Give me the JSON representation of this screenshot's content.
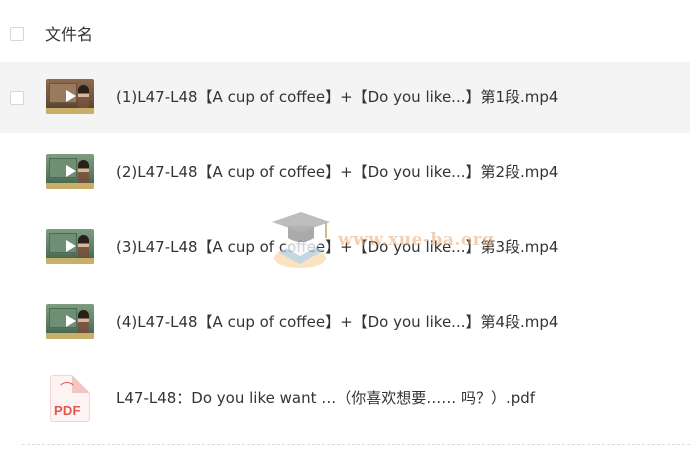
{
  "header": {
    "column_title": "文件名"
  },
  "files": [
    {
      "name": "(1)L47-L48【A cup of coffee】+【Do you like...】第1段.mp4",
      "type": "video",
      "thumbnail_icon": "video-thumbnail-icon",
      "selected": true
    },
    {
      "name": "(2)L47-L48【A cup of coffee】+【Do you like...】第2段.mp4",
      "type": "video",
      "thumbnail_icon": "video-thumbnail-icon",
      "selected": false
    },
    {
      "name": "(3)L47-L48【A cup of coffee】+【Do you like...】第3段.mp4",
      "type": "video",
      "thumbnail_icon": "video-thumbnail-icon",
      "selected": false
    },
    {
      "name": "(4)L47-L48【A cup of coffee】+【Do you like...】第4段.mp4",
      "type": "video",
      "thumbnail_icon": "video-thumbnail-icon",
      "selected": false
    },
    {
      "name": "L47-L48：Do you like want …（你喜欢想要…… 吗？）.pdf",
      "type": "pdf",
      "thumbnail_icon": "pdf-file-icon",
      "icon_label": "PDF",
      "selected": false
    }
  ],
  "watermark": {
    "text": "www.xue-ba.org",
    "icon": "graduation-cap-icon"
  },
  "colors": {
    "text": "#333333",
    "row_hover_bg": "#f4f4f4",
    "pdf_accent": "#e2574c",
    "checkbox_border": "#d6d6d6"
  }
}
